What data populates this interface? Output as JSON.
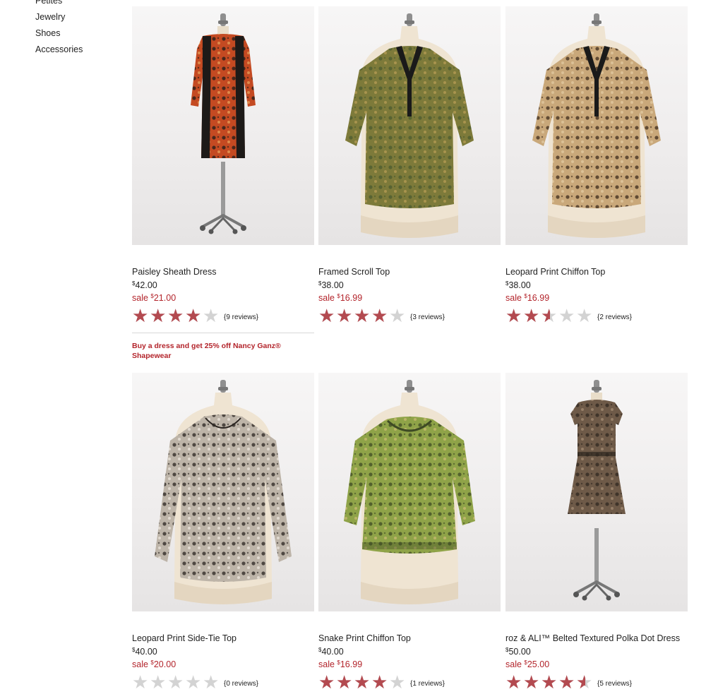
{
  "sidebar": {
    "items": [
      {
        "label": "Petites"
      },
      {
        "label": "Jewelry"
      },
      {
        "label": "Shoes"
      },
      {
        "label": "Accessories"
      }
    ]
  },
  "promo": {
    "text": "Buy a dress and get 25% off Nancy Ganz® Shapewear"
  },
  "currency_symbol": "$",
  "sale_prefix": "sale",
  "products": [
    {
      "name": "Paisley Sheath Dress",
      "price": "42.00",
      "sale_price": "21.00",
      "rating": 4,
      "reviews": "{9 reviews}",
      "garment": "dress",
      "palette": [
        "#c44a22",
        "#1d1a18",
        "#e39a55"
      ]
    },
    {
      "name": "Framed Scroll Top",
      "price": "38.00",
      "sale_price": "16.99",
      "rating": 4,
      "reviews": "{3 reviews}",
      "garment": "vneck",
      "palette": [
        "#7d7a3a",
        "#4a5a2e",
        "#b39a52"
      ]
    },
    {
      "name": "Leopard Print Chiffon Top",
      "price": "38.00",
      "sale_price": "16.99",
      "rating": 2.5,
      "reviews": "{2 reviews}",
      "garment": "vneck",
      "palette": [
        "#c9a87a",
        "#3d2a1a",
        "#e0c79f"
      ]
    },
    {
      "name": "Leopard Print Side-Tie Top",
      "price": "40.00",
      "sale_price": "20.00",
      "rating": 0,
      "reviews": "{0 reviews}",
      "garment": "longsleeve",
      "palette": [
        "#bdb4a8",
        "#2a2420",
        "#e8e2d8"
      ]
    },
    {
      "name": "Snake Print Chiffon Top",
      "price": "40.00",
      "sale_price": "16.99",
      "rating": 4,
      "reviews": "{1 reviews}",
      "garment": "peasant",
      "palette": [
        "#8fa348",
        "#3e4a24",
        "#c6b672"
      ]
    },
    {
      "name": "roz & ALI™ Belted Textured Polka Dot Dress",
      "price": "50.00",
      "sale_price": "25.00",
      "rating": 4.5,
      "reviews": "{5 reviews}",
      "garment": "capdress",
      "palette": [
        "#6e5a48",
        "#2e2620",
        "#a08870"
      ]
    }
  ]
}
